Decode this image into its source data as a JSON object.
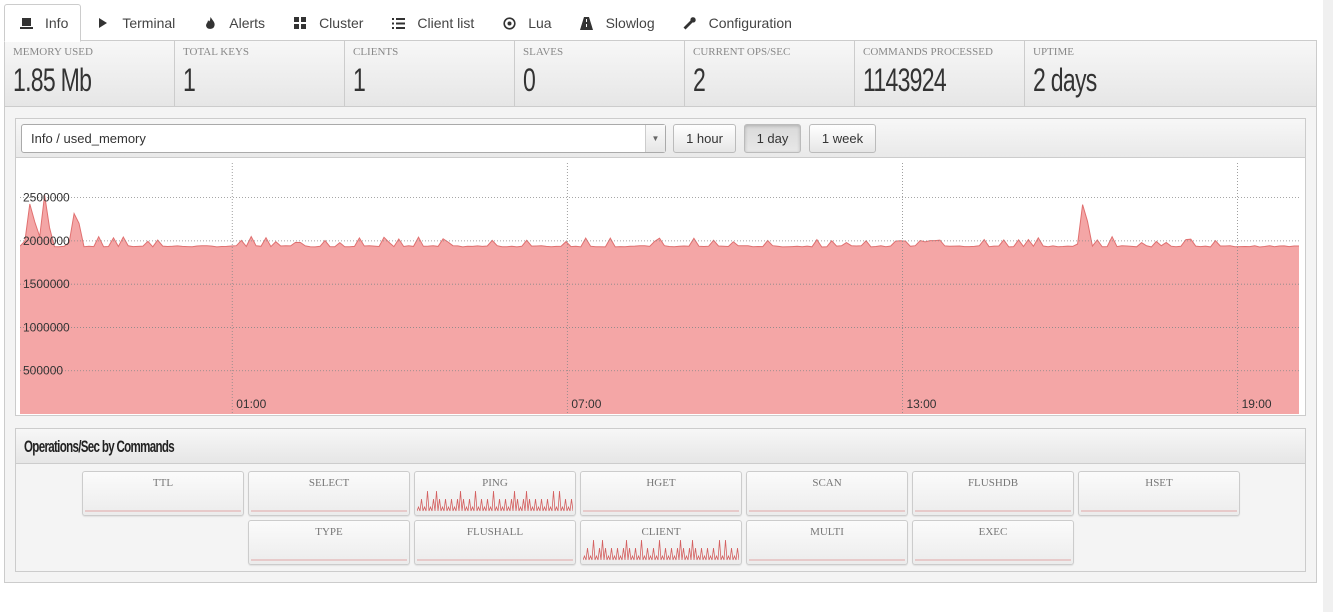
{
  "tabs": [
    {
      "label": "Info",
      "icon": "info-icon",
      "active": true
    },
    {
      "label": "Terminal",
      "icon": "terminal-icon"
    },
    {
      "label": "Alerts",
      "icon": "fire-icon"
    },
    {
      "label": "Cluster",
      "icon": "cluster-icon"
    },
    {
      "label": "Client list",
      "icon": "list-icon"
    },
    {
      "label": "Lua",
      "icon": "lua-icon"
    },
    {
      "label": "Slowlog",
      "icon": "road-icon"
    },
    {
      "label": "Configuration",
      "icon": "wrench-icon"
    }
  ],
  "stats": [
    {
      "label": "MEMORY USED",
      "value": "1.85 Mb"
    },
    {
      "label": "TOTAL KEYS",
      "value": "1"
    },
    {
      "label": "CLIENTS",
      "value": "1"
    },
    {
      "label": "SLAVES",
      "value": "0"
    },
    {
      "label": "CURRENT OPS/SEC",
      "value": "2"
    },
    {
      "label": "COMMANDS PROCESSED",
      "value": "1143924"
    },
    {
      "label": "UPTIME",
      "value": "2 days"
    }
  ],
  "metric_select": {
    "value": "Info / used_memory"
  },
  "range_buttons": [
    {
      "label": "1 hour",
      "active": false
    },
    {
      "label": "1 day",
      "active": true
    },
    {
      "label": "1 week",
      "active": false
    }
  ],
  "chart_data": {
    "type": "area",
    "title": "",
    "color": "#f4a6a6",
    "line_color": "#e07070",
    "ylim": [
      0,
      2900000
    ],
    "yticks": [
      500000,
      1000000,
      1500000,
      2000000,
      2500000
    ],
    "ytick_labels": [
      "500000",
      "1000000",
      "1500000",
      "2000000",
      "2500000"
    ],
    "xticks": [
      "01:00",
      "07:00",
      "13:00",
      "19:00"
    ],
    "xtick_hours": [
      1,
      7,
      13,
      19
    ],
    "x_start_hour": -2.8,
    "x_end_hour": 20.1,
    "baseline": 1930000,
    "spikes": [
      {
        "hour": -2.6,
        "value": 2550000
      },
      {
        "hour": -2.35,
        "value": 2580000
      },
      {
        "hour": -1.8,
        "value": 2450000
      },
      {
        "hour": 4.8,
        "value": 2050000
      },
      {
        "hour": 16.25,
        "value": 2550000
      }
    ],
    "grid": true
  },
  "ops": {
    "title": "Operations/Sec by Commands",
    "commands": [
      {
        "name": "TTL",
        "spark": false
      },
      {
        "name": "SELECT",
        "spark": false
      },
      {
        "name": "PING",
        "spark": true
      },
      {
        "name": "HGET",
        "spark": false
      },
      {
        "name": "SCAN",
        "spark": false
      },
      {
        "name": "FLUSHDB",
        "spark": false
      },
      {
        "name": "HSET",
        "spark": false
      },
      {
        "name": "TYPE",
        "spark": false
      },
      {
        "name": "FLUSHALL",
        "spark": false
      },
      {
        "name": "CLIENT",
        "spark": true
      },
      {
        "name": "MULTI",
        "spark": false
      },
      {
        "name": "EXEC",
        "spark": false
      }
    ]
  }
}
